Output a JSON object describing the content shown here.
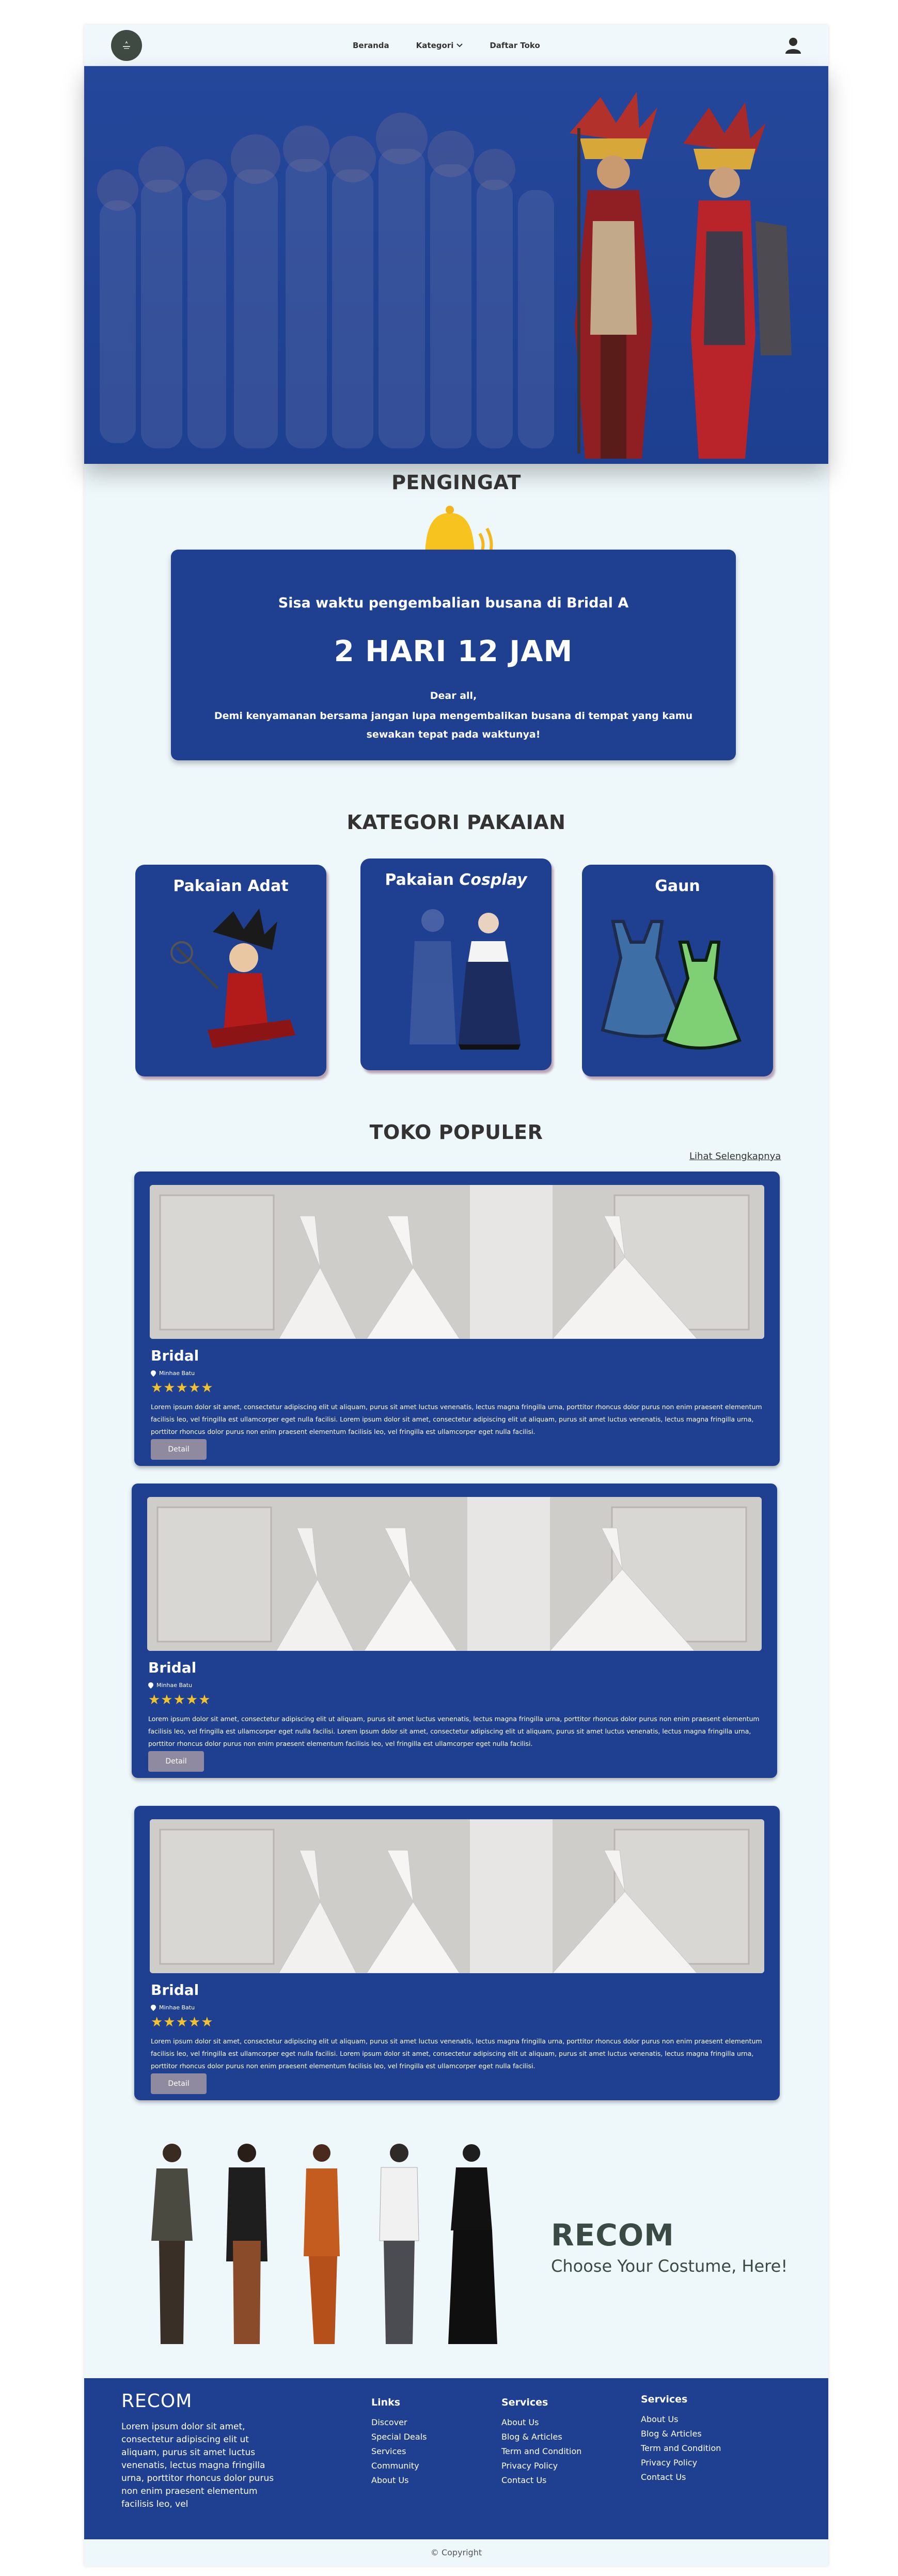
{
  "nav": {
    "items": [
      {
        "label": "Beranda"
      },
      {
        "label": "Kategori",
        "has_dropdown": true
      },
      {
        "label": "Daftar Toko"
      }
    ],
    "icons": {
      "logo": "brand-logo",
      "user": "user-icon",
      "dropdown": "chevron-down-icon"
    }
  },
  "reminder": {
    "section_title": "PENGINGAT",
    "line1": "Sisa waktu pengembalian busana di Bridal A",
    "countdown": "2 HARI 12 JAM",
    "greeting": "Dear all,",
    "message": "Demi kenyamanan bersama jangan lupa mengembalikan busana di tempat yang kamu sewakan tepat pada waktunya!"
  },
  "categories": {
    "section_title": "KATEGORI PAKAIAN",
    "items": [
      {
        "label": "Pakaian Adat"
      },
      {
        "label_prefix": "Pakaian ",
        "label_italic": "Cosplay"
      },
      {
        "label": "Gaun"
      }
    ]
  },
  "shops": {
    "section_title": "TOKO POPULER",
    "see_more": "Lihat Selengkapnya",
    "items": [
      {
        "name": "Bridal",
        "location": "Minhae Batu",
        "rating": "★★★★★",
        "description": "Lorem ipsum dolor sit amet, consectetur adipiscing elit ut aliquam, purus sit amet luctus venenatis, lectus magna fringilla urna, porttitor rhoncus dolor purus non enim praesent elementum facilisis leo, vel fringilla est ullamcorper eget nulla facilisi. Lorem ipsum dolor sit amet, consectetur adipiscing elit ut aliquam, purus sit amet luctus venenatis, lectus magna fringilla urna, porttitor rhoncus dolor purus non enim praesent elementum facilisis leo, vel fringilla est ullamcorper eget nulla facilisi.",
        "button": "Detail"
      },
      {
        "name": "Bridal",
        "location": "Minhae Batu",
        "rating": "★★★★★",
        "description": "Lorem ipsum dolor sit amet, consectetur adipiscing elit ut aliquam, purus sit amet luctus venenatis, lectus magna fringilla urna, porttitor rhoncus dolor purus non enim praesent elementum facilisis leo, vel fringilla est ullamcorper eget nulla facilisi. Lorem ipsum dolor sit amet, consectetur adipiscing elit ut aliquam, purus sit amet luctus venenatis, lectus magna fringilla urna, porttitor rhoncus dolor purus non enim praesent elementum facilisis leo, vel fringilla est ullamcorper eget nulla facilisi.",
        "button": "Detail"
      },
      {
        "name": "Bridal",
        "location": "Minhae Batu",
        "rating": "★★★★★",
        "description": "Lorem ipsum dolor sit amet, consectetur adipiscing elit ut aliquam, purus sit amet luctus venenatis, lectus magna fringilla urna, porttitor rhoncus dolor purus non enim praesent elementum facilisis leo, vel fringilla est ullamcorper eget nulla facilisi. Lorem ipsum dolor sit amet, consectetur adipiscing elit ut aliquam, purus sit amet luctus venenatis, lectus magna fringilla urna, porttitor rhoncus dolor purus non enim praesent elementum facilisis leo, vel fringilla est ullamcorper eget nulla facilisi.",
        "button": "Detail"
      }
    ]
  },
  "recom": {
    "title": "RECOM",
    "subtitle": "Choose Your Costume, Here!"
  },
  "footer": {
    "brand": "RECOM",
    "about": "Lorem ipsum dolor sit amet, consectetur adipiscing elit ut aliquam, purus sit amet luctus venenatis, lectus magna fringilla urna, porttitor rhoncus dolor purus non enim praesent elementum facilisis leo, vel",
    "columns": [
      {
        "title": "Links",
        "items": [
          "Discover",
          "Special Deals",
          "Services",
          "Community",
          "About Us"
        ]
      },
      {
        "title": "Services",
        "items": [
          "About Us",
          "Blog & Articles",
          "Term and Condition",
          "Privacy Policy",
          "Contact Us"
        ]
      },
      {
        "title": "Services",
        "items": [
          "About Us",
          "Blog & Articles",
          "Term and Condition",
          "Privacy Policy",
          "Contact Us"
        ]
      }
    ],
    "copyright": "© Copyright"
  },
  "colors": {
    "primary": "#1f4090",
    "background": "#eef8fb",
    "star": "#f2c12e",
    "button": "#8f8aa0",
    "heading": "#333333"
  }
}
